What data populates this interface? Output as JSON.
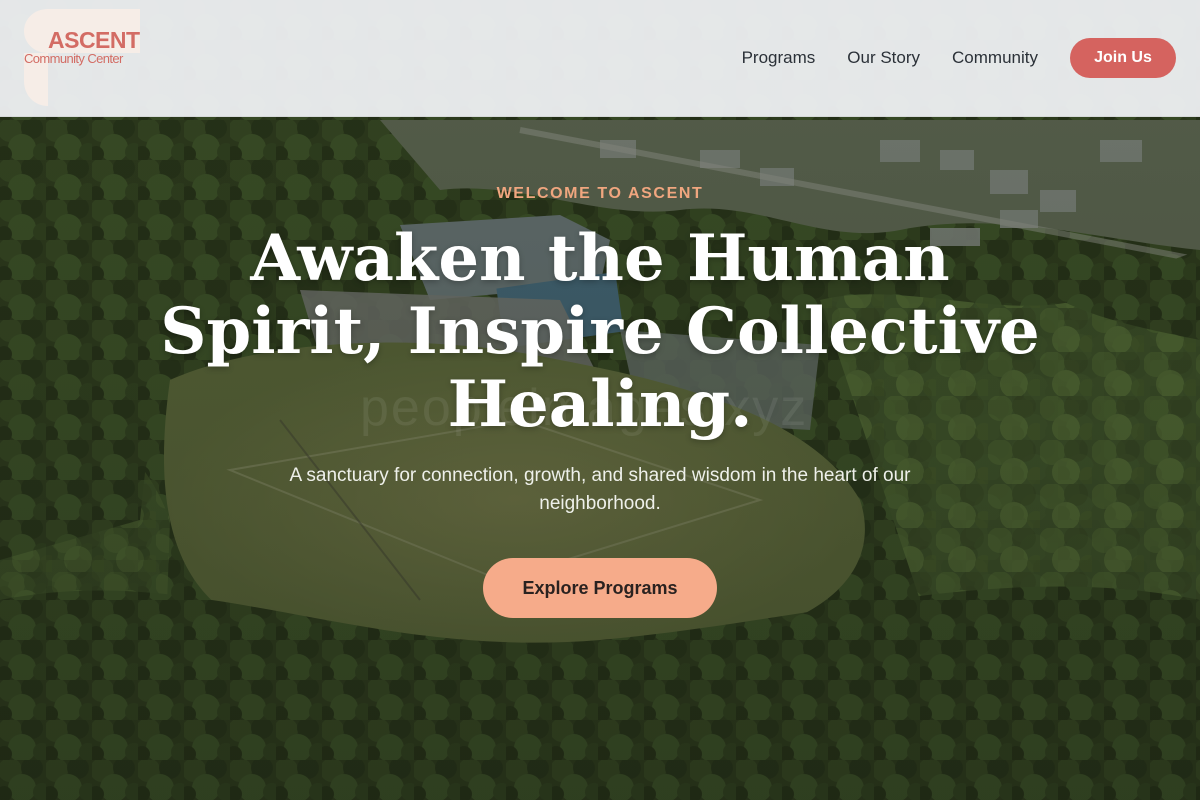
{
  "brand": {
    "name": "ASCENT",
    "tagline": "Community Center",
    "accent_color": "#d5635f",
    "logo_icon": "logo-mark-icon"
  },
  "nav": {
    "items": [
      {
        "label": "Programs"
      },
      {
        "label": "Our Story"
      },
      {
        "label": "Community"
      }
    ],
    "cta_label": "Join Us"
  },
  "hero": {
    "eyebrow": "WELCOME TO ASCENT",
    "headline": "Awaken the Human Spirit, Inspire Collective Healing.",
    "subheadline": "A sanctuary for connection, growth, and shared wisdom in the heart of our neighborhood.",
    "cta_label": "Explore Programs",
    "cta_color": "#f6ab8a",
    "eyebrow_color": "#f0a67f",
    "background": "aerial view of a community park surrounded by trees",
    "watermark": "peopleimages.xyz"
  }
}
